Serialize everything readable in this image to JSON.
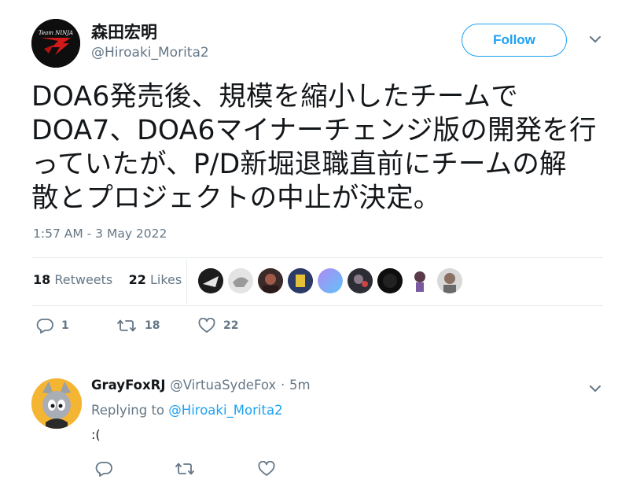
{
  "tweet": {
    "author_name": "森田宏明",
    "author_handle": "@Hiroaki_Morita2",
    "avatar_logo_text": "Team NINJA",
    "follow_label": "Follow",
    "text": "DOA6発売後、規模を縮小したチームで\nDOA7、DOA6マイナーチェンジ版の開発を行\nっていたが、P/D新堀退職直前にチームの解\n散とプロジェクトの中止が決定。",
    "timestamp": "1:57 AM - 3 May 2022",
    "retweets_count": "18",
    "retweets_label": "Retweets",
    "likes_count": "22",
    "likes_label": "Likes",
    "actions": {
      "reply_count": "1",
      "retweet_count": "18",
      "like_count": "22"
    }
  },
  "reply": {
    "author_name": "GrayFoxRJ",
    "author_handle": "@VirtuaSydeFox",
    "separator": "·",
    "time": "5m",
    "replying_prefix": "Replying to",
    "replying_to": "@Hiroaki_Morita2",
    "text": ":("
  },
  "icons": {
    "reply": "reply-icon",
    "retweet": "retweet-icon",
    "like": "heart-icon",
    "more": "chevron-down-icon"
  },
  "colors": {
    "accent": "#1da1f2",
    "secondary_text": "#657786",
    "divider": "#e6ecf0"
  }
}
